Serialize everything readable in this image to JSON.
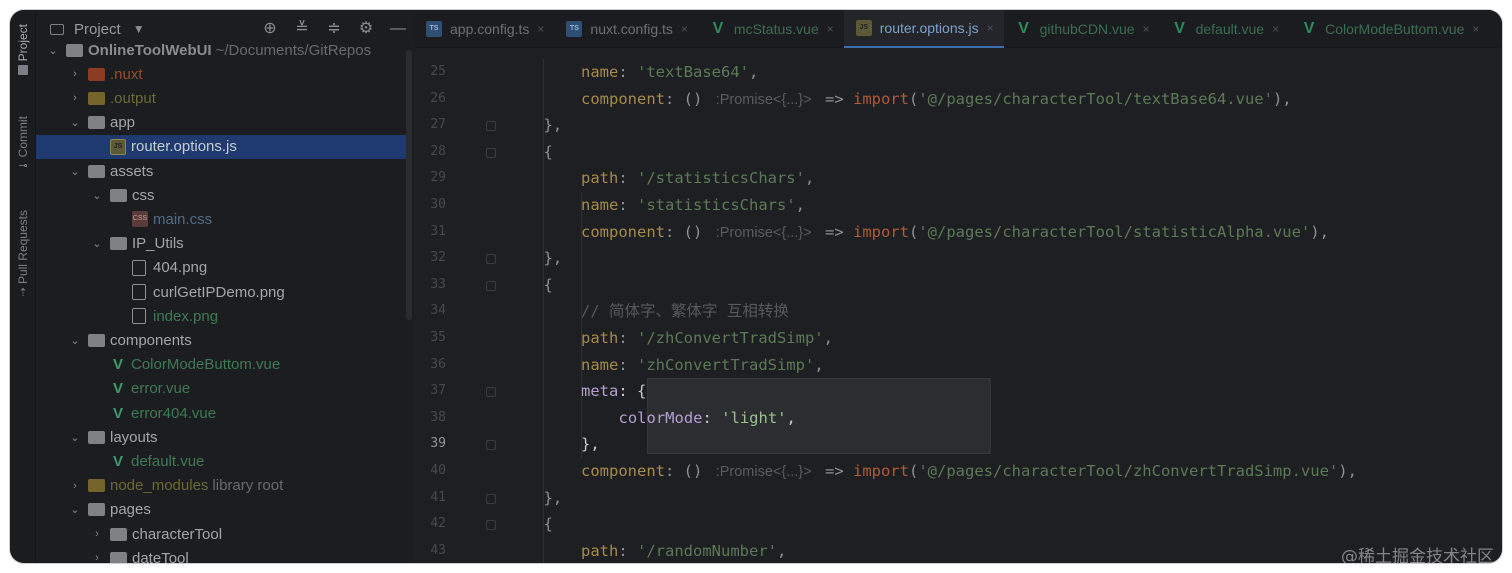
{
  "activity_bar": {
    "items": [
      {
        "label": "Project",
        "icon": "folder-icon"
      },
      {
        "label": "Commit",
        "icon": "commit-icon"
      },
      {
        "label": "Pull Requests",
        "icon": "pull-request-icon"
      }
    ]
  },
  "project_panel": {
    "title": "Project",
    "tools": [
      "locate-icon",
      "expand-all-icon",
      "collapse-all-icon",
      "settings-icon",
      "hide-icon"
    ],
    "tree": [
      {
        "label": "OnlineToolWebUI",
        "suffix": "~/Documents/GitRepos",
        "depth": 0,
        "arrow": "expanded",
        "kind": "folder",
        "style": "bold"
      },
      {
        "label": ".nuxt",
        "depth": 1,
        "arrow": "collapsed",
        "kind": "folder-orange",
        "style": "orange"
      },
      {
        "label": ".output",
        "depth": 1,
        "arrow": "collapsed",
        "kind": "folder-gold",
        "style": "gold"
      },
      {
        "label": "app",
        "depth": 1,
        "arrow": "expanded",
        "kind": "folder",
        "style": "normal"
      },
      {
        "label": "router.options.js",
        "depth": 2,
        "arrow": "none",
        "kind": "js",
        "style": "white",
        "selected": true
      },
      {
        "label": "assets",
        "depth": 1,
        "arrow": "expanded",
        "kind": "folder",
        "style": "normal"
      },
      {
        "label": "css",
        "depth": 2,
        "arrow": "expanded",
        "kind": "folder",
        "style": "normal"
      },
      {
        "label": "main.css",
        "depth": 3,
        "arrow": "none",
        "kind": "css",
        "style": "css"
      },
      {
        "label": "IP_Utils",
        "depth": 2,
        "arrow": "expanded",
        "kind": "folder",
        "style": "normal"
      },
      {
        "label": "404.png",
        "depth": 3,
        "arrow": "none",
        "kind": "png",
        "style": "normal"
      },
      {
        "label": "curlGetIPDemo.png",
        "depth": 3,
        "arrow": "none",
        "kind": "png",
        "style": "normal"
      },
      {
        "label": "index.png",
        "depth": 3,
        "arrow": "none",
        "kind": "png",
        "style": "green"
      },
      {
        "label": "components",
        "depth": 1,
        "arrow": "expanded",
        "kind": "folder",
        "style": "normal"
      },
      {
        "label": "ColorModeButtom.vue",
        "depth": 2,
        "arrow": "none",
        "kind": "vue",
        "style": "green"
      },
      {
        "label": "error.vue",
        "depth": 2,
        "arrow": "none",
        "kind": "vue",
        "style": "green"
      },
      {
        "label": "error404.vue",
        "depth": 2,
        "arrow": "none",
        "kind": "vue",
        "style": "green"
      },
      {
        "label": "layouts",
        "depth": 1,
        "arrow": "expanded",
        "kind": "folder",
        "style": "normal"
      },
      {
        "label": "default.vue",
        "depth": 2,
        "arrow": "none",
        "kind": "vue",
        "style": "green"
      },
      {
        "label": "node_modules",
        "suffix": "library root",
        "depth": 1,
        "arrow": "collapsed",
        "kind": "folder-gold",
        "style": "gold"
      },
      {
        "label": "pages",
        "depth": 1,
        "arrow": "expanded",
        "kind": "folder",
        "style": "normal"
      },
      {
        "label": "characterTool",
        "depth": 2,
        "arrow": "collapsed",
        "kind": "folder",
        "style": "normal"
      },
      {
        "label": "dateTool",
        "depth": 2,
        "arrow": "collapsed",
        "kind": "folder",
        "style": "normal"
      }
    ]
  },
  "editor": {
    "tabs": [
      {
        "label": "app.config.ts",
        "kind": "ts"
      },
      {
        "label": "nuxt.config.ts",
        "kind": "ts"
      },
      {
        "label": "mcStatus.vue",
        "kind": "vue"
      },
      {
        "label": "router.options.js",
        "kind": "js",
        "active": true
      },
      {
        "label": "githubCDN.vue",
        "kind": "vue"
      },
      {
        "label": "default.vue",
        "kind": "vue"
      },
      {
        "label": "ColorModeButtom.vue",
        "kind": "vue"
      }
    ],
    "current_line": 39,
    "lines": [
      {
        "n": 25,
        "indent": 2,
        "tokens": [
          [
            "k",
            "name"
          ],
          [
            "p",
            ": "
          ],
          [
            "s",
            "'textBase64'"
          ],
          [
            "p",
            ","
          ]
        ]
      },
      {
        "n": 26,
        "indent": 2,
        "tokens": [
          [
            "k",
            "component"
          ],
          [
            "p",
            ": () "
          ],
          [
            "hint",
            " :Promise<{...}> "
          ],
          [
            "p",
            " => "
          ],
          [
            "imp",
            "import"
          ],
          [
            "p",
            "("
          ],
          [
            "s",
            "'@/pages/characterTool/textBase64.vue'"
          ],
          [
            "p",
            "),"
          ]
        ]
      },
      {
        "n": 27,
        "indent": 1,
        "tokens": [
          [
            "p",
            "},"
          ]
        ]
      },
      {
        "n": 28,
        "indent": 1,
        "tokens": [
          [
            "p",
            "{"
          ]
        ]
      },
      {
        "n": 29,
        "indent": 2,
        "tokens": [
          [
            "k",
            "path"
          ],
          [
            "p",
            ": "
          ],
          [
            "s",
            "'/statisticsChars'"
          ],
          [
            "p",
            ","
          ]
        ]
      },
      {
        "n": 30,
        "indent": 2,
        "tokens": [
          [
            "k",
            "name"
          ],
          [
            "p",
            ": "
          ],
          [
            "s",
            "'statisticsChars'"
          ],
          [
            "p",
            ","
          ]
        ]
      },
      {
        "n": 31,
        "indent": 2,
        "tokens": [
          [
            "k",
            "component"
          ],
          [
            "p",
            ": () "
          ],
          [
            "hint",
            " :Promise<{...}> "
          ],
          [
            "p",
            " => "
          ],
          [
            "imp",
            "import"
          ],
          [
            "p",
            "("
          ],
          [
            "s",
            "'@/pages/characterTool/statisticAlpha.vue'"
          ],
          [
            "p",
            "),"
          ]
        ]
      },
      {
        "n": 32,
        "indent": 1,
        "tokens": [
          [
            "p",
            "},"
          ]
        ]
      },
      {
        "n": 33,
        "indent": 1,
        "tokens": [
          [
            "p",
            "{"
          ]
        ]
      },
      {
        "n": 34,
        "indent": 2,
        "tokens": [
          [
            "cm",
            "// 简体字、繁体字 互相转换"
          ]
        ]
      },
      {
        "n": 35,
        "indent": 2,
        "tokens": [
          [
            "k",
            "path"
          ],
          [
            "p",
            ": "
          ],
          [
            "s",
            "'/zhConvertTradSimp'"
          ],
          [
            "p",
            ","
          ]
        ]
      },
      {
        "n": 36,
        "indent": 2,
        "tokens": [
          [
            "k",
            "name"
          ],
          [
            "p",
            ": "
          ],
          [
            "s",
            "'zhConvertTradSimp'"
          ],
          [
            "p",
            ","
          ]
        ]
      },
      {
        "n": 37,
        "indent": 2,
        "hl": true,
        "tokens": [
          [
            "k2",
            "meta"
          ],
          [
            "p2",
            ": {"
          ]
        ]
      },
      {
        "n": 38,
        "indent": 3,
        "hl": true,
        "tokens": [
          [
            "k2",
            "colorMode"
          ],
          [
            "p2",
            ": "
          ],
          [
            "s2",
            "'light'"
          ],
          [
            "p2",
            ","
          ]
        ]
      },
      {
        "n": 39,
        "indent": 2,
        "hl": true,
        "tokens": [
          [
            "p2",
            "},"
          ]
        ]
      },
      {
        "n": 40,
        "indent": 2,
        "tokens": [
          [
            "k",
            "component"
          ],
          [
            "p",
            ": () "
          ],
          [
            "hint",
            " :Promise<{...}> "
          ],
          [
            "p",
            " => "
          ],
          [
            "imp",
            "import"
          ],
          [
            "p",
            "("
          ],
          [
            "s",
            "'@/pages/characterTool/zhConvertTradSimp.vue'"
          ],
          [
            "p",
            "),"
          ]
        ]
      },
      {
        "n": 41,
        "indent": 1,
        "tokens": [
          [
            "p",
            "},"
          ]
        ]
      },
      {
        "n": 42,
        "indent": 1,
        "tokens": [
          [
            "p",
            "{"
          ]
        ]
      },
      {
        "n": 43,
        "indent": 2,
        "tokens": [
          [
            "k",
            "path"
          ],
          [
            "p",
            ": "
          ],
          [
            "s",
            "'/randomNumber'"
          ],
          [
            "p",
            ","
          ]
        ]
      }
    ]
  },
  "watermark": "@稀土掘金技术社区"
}
